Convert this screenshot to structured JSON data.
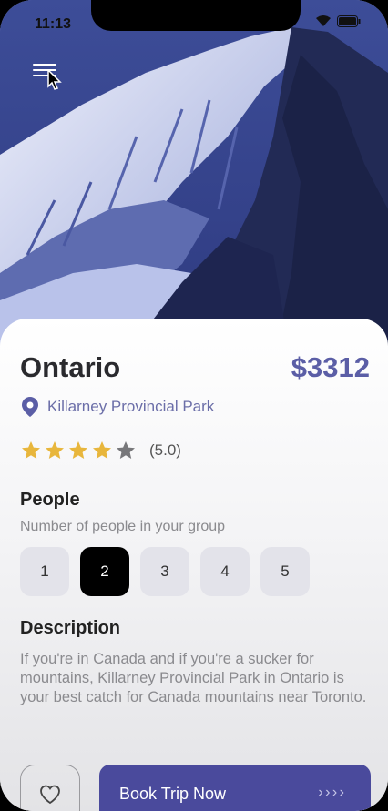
{
  "status_bar": {
    "time": "11:13"
  },
  "icons": {
    "menu": "menu-icon",
    "location": "location-pin-icon",
    "star": "star-icon",
    "heart": "heart-icon",
    "arrows": "chevrons-right-icon"
  },
  "colors": {
    "accent": "#5b5ea6",
    "button": "#4a4a9c",
    "star_filled": "#e8b63c",
    "star_empty": "#77777a"
  },
  "trip": {
    "title": "Ontario",
    "price": "$3312",
    "location": "Killarney Provincial Park",
    "rating": {
      "filled_stars": 4,
      "total_stars": 5,
      "label": "(5.0)"
    }
  },
  "people": {
    "title": "People",
    "subtitle": "Number of people in your group",
    "options": [
      "1",
      "2",
      "3",
      "4",
      "5"
    ],
    "selected": "2"
  },
  "description": {
    "title": "Description",
    "text": "If you're in Canada and if you're a sucker for mountains, Killarney Provincial Park in Ontario is your best catch for Canada mountains near Toronto."
  },
  "actions": {
    "book_label": "Book Trip Now",
    "book_arrows": "› › › ›"
  }
}
